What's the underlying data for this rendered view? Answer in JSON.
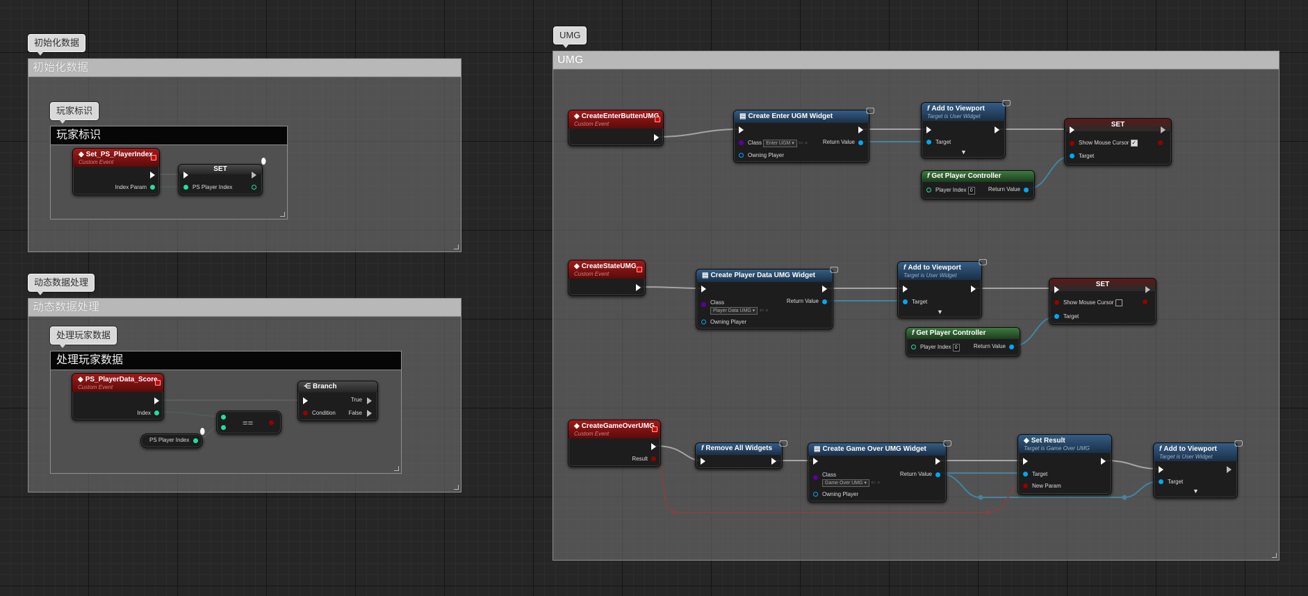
{
  "groups": {
    "init": {
      "bubble": "初始化数据",
      "title": "初始化数据",
      "player_id": {
        "bubble": "玩家标识",
        "title": "玩家标识"
      }
    },
    "dynamic": {
      "bubble": "动态数据处理",
      "title": "动态数据处理",
      "process": {
        "bubble": "处理玩家数据",
        "title": "处理玩家数据"
      }
    },
    "umg": {
      "bubble": "UMG",
      "title": "UMG"
    }
  },
  "nodes": {
    "set_ps_playerindex": {
      "title": "Set_PS_PlayerIndex",
      "subtitle": "Custom Event",
      "pin_out": "Index Param"
    },
    "set_ps_player_index": {
      "title": "SET",
      "pin_in": "PS Player Index"
    },
    "ps_playerdata_score": {
      "title": "PS_PlayerData_Score",
      "subtitle": "Custom Event",
      "pin_out": "Index"
    },
    "ps_player_index_getter": {
      "label": "PS Player Index"
    },
    "equal": {
      "label": "=="
    },
    "branch": {
      "title": "Branch",
      "pin_condition": "Condition",
      "pin_true": "True",
      "pin_false": "False"
    },
    "create_enter_event": {
      "title": "CreateEnterButtenUMG",
      "subtitle": "Custom Event"
    },
    "create_enter_widget": {
      "title": "Create Enter UGM Widget",
      "class_label": "Class",
      "class_value": "Enter UGM",
      "owning": "Owning Player",
      "return": "Return Value"
    },
    "add_viewport_1": {
      "title": "Add to Viewport",
      "subtitle": "Target is User Widget",
      "target": "Target"
    },
    "set_cursor_1": {
      "title": "SET",
      "show": "Show Mouse Cursor",
      "checked": "✓",
      "target": "Target"
    },
    "get_pc_1": {
      "title": "Get Player Controller",
      "index_label": "Player Index",
      "index_value": "0",
      "return": "Return Value"
    },
    "create_state_event": {
      "title": "CreateStateUMG",
      "subtitle": "Custom Event"
    },
    "create_pd_widget": {
      "title": "Create Player Data UMG Widget",
      "class_label": "Class",
      "class_value": "Player Data UMG",
      "owning": "Owning Player",
      "return": "Return Value"
    },
    "add_viewport_2": {
      "title": "Add to Viewport",
      "subtitle": "Target is User Widget",
      "target": "Target"
    },
    "set_cursor_2": {
      "title": "SET",
      "show": "Show Mouse Cursor",
      "target": "Target"
    },
    "get_pc_2": {
      "title": "Get Player Controller",
      "index_label": "Player Index",
      "index_value": "0",
      "return": "Return Value"
    },
    "create_gameover_event": {
      "title": "CreateGameOverUMG",
      "subtitle": "Custom Event",
      "result": "Result"
    },
    "remove_widgets": {
      "title": "Remove All Widgets"
    },
    "create_go_widget": {
      "title": "Create Game Over UMG Widget",
      "class_label": "Class",
      "class_value": "Game Over UMG",
      "owning": "Owning Player",
      "return": "Return Value"
    },
    "set_result": {
      "title": "Set Result",
      "subtitle": "Target is Game Over UMG",
      "target": "Target",
      "param": "New Param"
    },
    "add_viewport_3": {
      "title": "Add to Viewport",
      "subtitle": "Target is User Widget",
      "target": "Target"
    }
  },
  "colors": {
    "exec": "#ffffff",
    "object": "#00a8f4",
    "integer": "#1fe0a0",
    "boolean": "#950000",
    "class": "#5a00a0",
    "event_header": "#a11a1a",
    "function_header": "#355d84",
    "pure_header": "#3f7a40"
  }
}
